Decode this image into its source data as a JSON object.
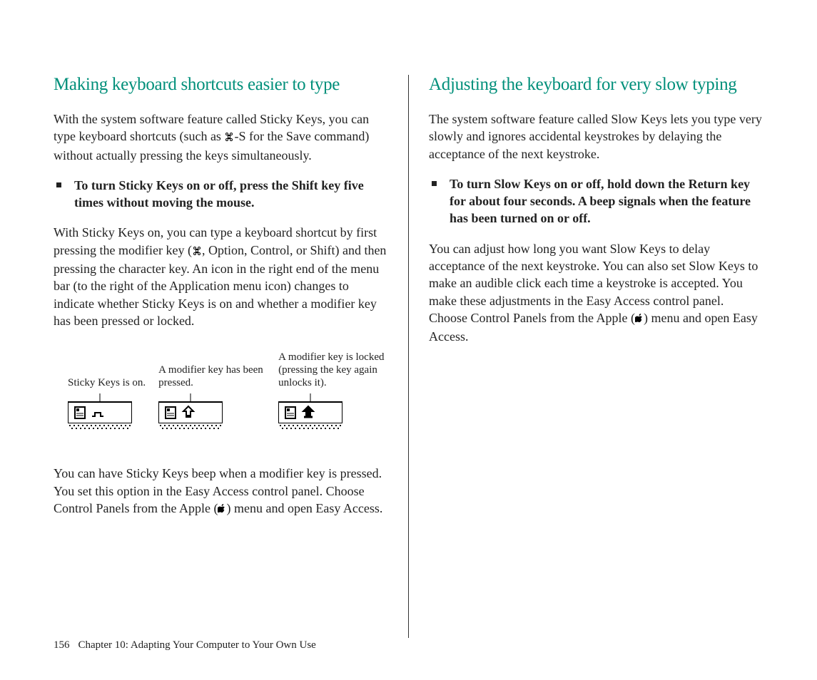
{
  "left": {
    "heading": "Making keyboard shortcuts easier to type",
    "p1a": "With the system software feature called Sticky Keys, you can type keyboard shortcuts (such as ",
    "p1b": "-S for the Save command) without actually pressing the keys simultaneously.",
    "bullet": "To turn Sticky Keys on or off, press the Shift key five times without moving the mouse.",
    "p2a": "With Sticky Keys on, you can type a keyboard shortcut by first pressing the modifier key (",
    "p2b": ", Option, Control, or Shift) and then pressing the character key. An icon in the right end of the menu bar (to the right of the Application menu icon) changes to indicate whether Sticky Keys is on and whether a modifier key has been pressed or locked.",
    "fig": {
      "c1": "Sticky Keys is on.",
      "c2": "A modifier key has been pressed.",
      "c3": "A modifier key is locked (pressing the key again unlocks it)."
    },
    "p3a": "You can have Sticky Keys beep when a modifier key is pressed. You set this option in the Easy Access control panel. Choose Control Panels from the Apple (",
    "p3b": ") menu and open Easy Access."
  },
  "right": {
    "heading": "Adjusting the keyboard for very slow typing",
    "p1": "The system software feature called Slow Keys lets you type very slowly and ignores accidental keystrokes by delaying the acceptance of the next keystroke.",
    "bullet": "To turn Slow Keys on or off, hold down the Return key for about four seconds. A beep signals when the feature has been turned on or off.",
    "p2a": "You can adjust how long you want Slow Keys to delay acceptance of the next keystroke. You can also set Slow Keys to make an audible click each time a keystroke is accepted. You make these adjustments in the Easy Access control panel. Choose Control Panels from the Apple (",
    "p2b": ") menu and open Easy Access."
  },
  "footer": {
    "page": "156",
    "chapter": "Chapter 10:  Adapting Your Computer to Your Own Use"
  }
}
